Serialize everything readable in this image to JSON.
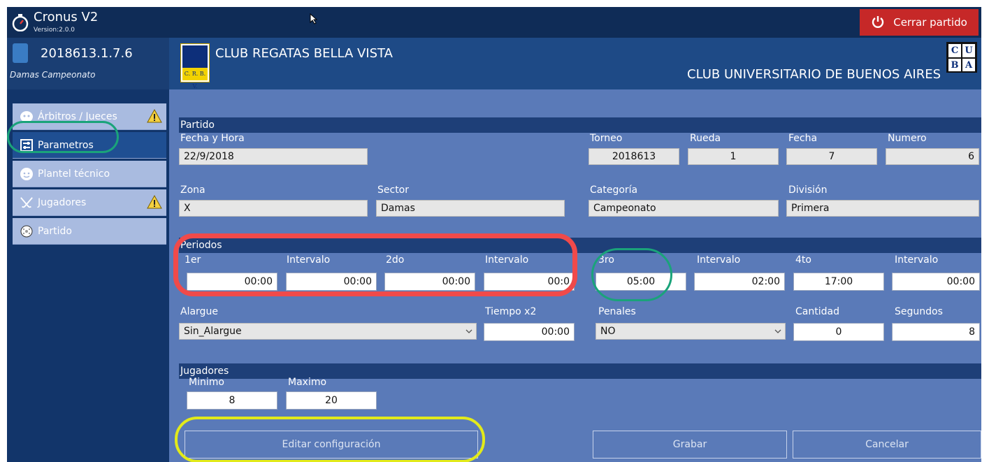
{
  "app": {
    "title": "Cronus V2",
    "version": "Version:2.0.0",
    "close_label": "Cerrar partido"
  },
  "match": {
    "code": "2018613.1.7.6",
    "category_line": "Damas Campeonato",
    "home_team": "CLUB REGATAS BELLA VISTA",
    "away_team": "CLUB UNIVERSITARIO DE BUENOS AIRES",
    "home_logo_text": "C. R. B. V.",
    "away_logo_letters": [
      "C",
      "U",
      "B",
      "A"
    ]
  },
  "sidebar": {
    "items": [
      {
        "label": "Árbitros / Jueces",
        "icon": "referee-mask-icon",
        "warning": true
      },
      {
        "label": "Parametros",
        "icon": "settings-icon",
        "warning": false,
        "active": true
      },
      {
        "label": "Plantel técnico",
        "icon": "coach-icon",
        "warning": false
      },
      {
        "label": "Jugadores",
        "icon": "hockey-sticks-icon",
        "warning": true
      },
      {
        "label": "Partido",
        "icon": "ball-icon",
        "warning": false
      }
    ]
  },
  "partido": {
    "section": "Partido",
    "fecha_hora_label": "Fecha y Hora",
    "fecha_hora": "22/9/2018",
    "torneo_label": "Torneo",
    "torneo": "2018613",
    "rueda_label": "Rueda",
    "rueda": "1",
    "fecha_label": "Fecha",
    "fecha": "7",
    "numero_label": "Numero",
    "numero": "6",
    "zona_label": "Zona",
    "zona": "X",
    "sector_label": "Sector",
    "sector": "Damas",
    "categoria_label": "Categoría",
    "categoria": "Campeonato",
    "division_label": "División",
    "division": "Primera"
  },
  "periodos": {
    "section": "Periodos",
    "p1_label": "1er",
    "p1": "00:00",
    "i1_label": "Intervalo",
    "i1": "00:00",
    "p2_label": "2do",
    "p2": "00:00",
    "i2_label": "Intervalo",
    "i2": "00:0",
    "p3_label": "3ro",
    "p3": "05:00",
    "i3_label": "Intervalo",
    "i3": "02:00",
    "p4_label": "4to",
    "p4": "17:00",
    "i4_label": "Intervalo",
    "i4": "00:00",
    "alargue_label": "Alargue",
    "alargue": "Sin_Alargue",
    "tiempo_label": "Tiempo x2",
    "tiempo": "00:00",
    "penales_label": "Penales",
    "penales": "NO",
    "cantidad_label": "Cantidad",
    "cantidad": "0",
    "segundos_label": "Segundos",
    "segundos": "8"
  },
  "jugadores": {
    "section": "Jugadores",
    "minimo_label": "Minimo",
    "minimo": "8",
    "maximo_label": "Maximo",
    "maximo": "20"
  },
  "actions": {
    "edit_label": "Editar configuración",
    "save_label": "Grabar",
    "cancel_label": "Cancelar"
  },
  "colors": {
    "accent_red": "#c62828",
    "annotation_red": "#f04a4a",
    "annotation_teal": "#1aa37a",
    "annotation_yellow": "#e2ea1a"
  }
}
